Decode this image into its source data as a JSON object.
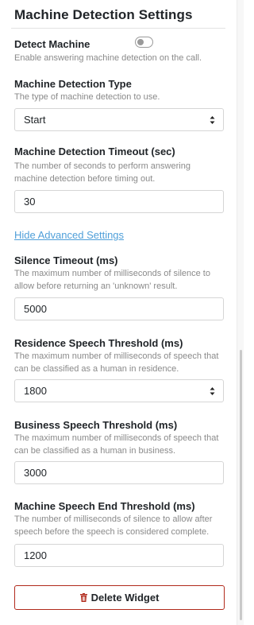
{
  "section": {
    "title": "Machine Detection Settings"
  },
  "detect_machine": {
    "label": "Detect Machine",
    "help": "Enable answering machine detection on the call.",
    "enabled": false
  },
  "detection_type": {
    "label": "Machine Detection Type",
    "help": "The type of machine detection to use.",
    "value": "Start"
  },
  "detection_timeout": {
    "label": "Machine Detection Timeout (sec)",
    "help": "The number of seconds to perform answering machine detection before timing out.",
    "value": "30"
  },
  "advanced_link": {
    "label": "Hide Advanced Settings"
  },
  "silence_timeout": {
    "label": "Silence Timeout (ms)",
    "help": "The maximum number of milliseconds of silence to allow before returning an 'unknown' result.",
    "value": "5000"
  },
  "residence_threshold": {
    "label": "Residence Speech Threshold (ms)",
    "help": "The maximum number of milliseconds of speech that can be classified as a human in residence.",
    "value": "1800"
  },
  "business_threshold": {
    "label": "Business Speech Threshold (ms)",
    "help": "The maximum number of milliseconds of speech that can be classified as a human in business.",
    "value": "3000"
  },
  "end_threshold": {
    "label": "Machine Speech End Threshold (ms)",
    "help": "The number of milliseconds of silence to allow after speech before the speech is considered complete.",
    "value": "1200"
  },
  "delete_button": {
    "label": "Delete Widget",
    "icon": "trash-icon",
    "color": "#b12a1c"
  },
  "colors": {
    "link": "#4f9fd9",
    "help_text": "#8a8a8a",
    "danger": "#b12a1c"
  }
}
